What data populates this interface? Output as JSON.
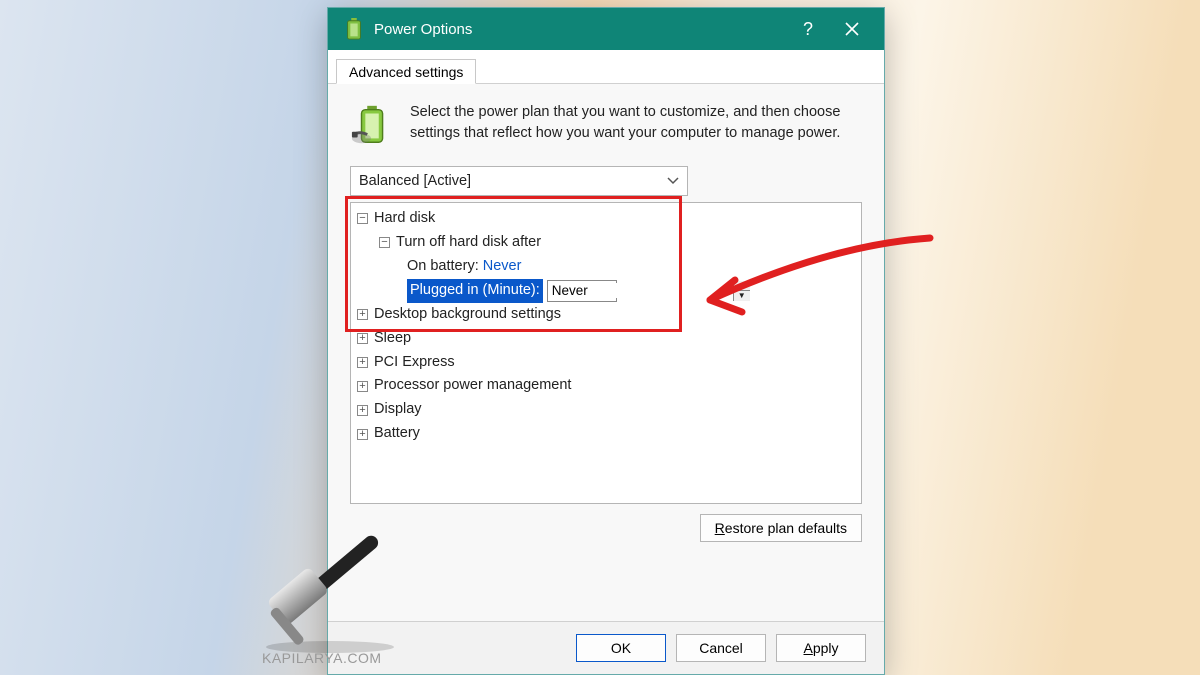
{
  "window": {
    "title": "Power Options"
  },
  "tab": {
    "label": "Advanced settings"
  },
  "intro": "Select the power plan that you want to customize, and then choose settings that reflect how you want your computer to manage power.",
  "plan": {
    "selected": "Balanced [Active]"
  },
  "tree": {
    "hard_disk": {
      "label": "Hard disk",
      "turn_off": {
        "label": "Turn off hard disk after",
        "on_battery_label": "On battery:",
        "on_battery_value": "Never",
        "plugged_in_label": "Plugged in (Minute):",
        "plugged_in_value": "Never"
      }
    },
    "items": [
      "Desktop background settings",
      "Sleep",
      "PCI Express",
      "Processor power management",
      "Display",
      "Battery"
    ]
  },
  "buttons": {
    "restore": "Restore plan defaults",
    "ok": "OK",
    "cancel": "Cancel",
    "apply": "Apply"
  },
  "watermark": "KAPILARYA.COM"
}
